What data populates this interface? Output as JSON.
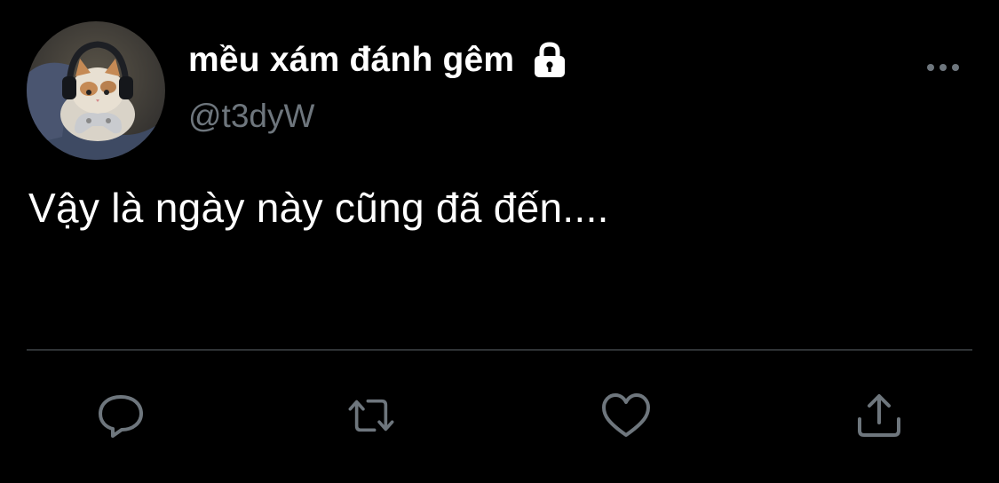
{
  "user": {
    "display_name": "mều xám đánh gêm",
    "handle": "@t3dyW",
    "protected_icon": "lock-icon",
    "avatar": "cat-with-headphones-avatar"
  },
  "tweet": {
    "text": "Vậy là ngày này cũng đã đến...."
  },
  "actions": [
    {
      "name": "reply",
      "icon": "reply-icon"
    },
    {
      "name": "retweet",
      "icon": "retweet-icon"
    },
    {
      "name": "like",
      "icon": "heart-icon"
    },
    {
      "name": "share",
      "icon": "share-icon"
    }
  ],
  "colors": {
    "background": "#000000",
    "text": "#ffffff",
    "secondary_text": "#6e767d",
    "divider": "#2f3336",
    "icon": "#6e767d"
  }
}
